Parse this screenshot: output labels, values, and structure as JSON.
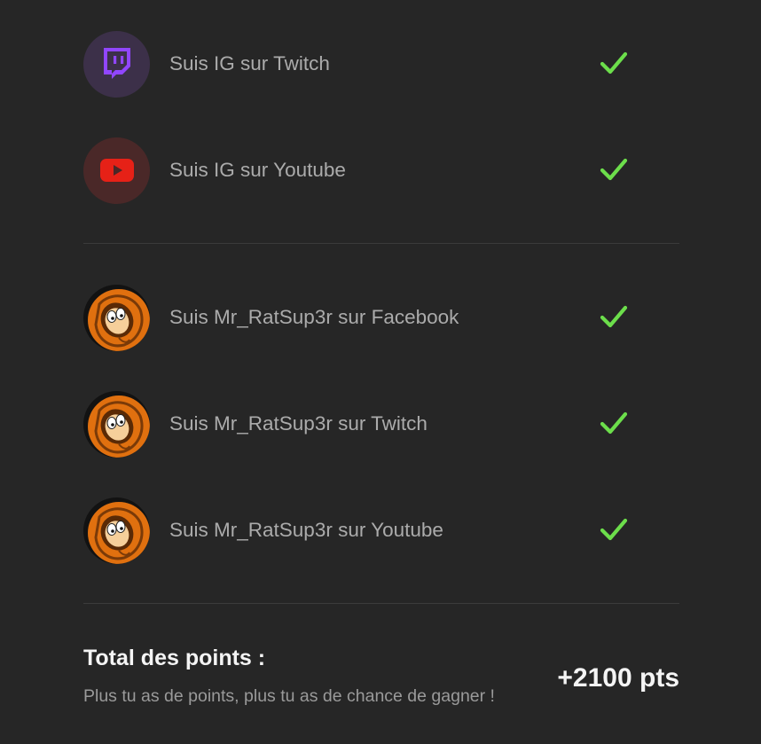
{
  "tasks_group_1": [
    {
      "label": "Suis IG sur Twitch",
      "icon": "twitch-icon",
      "completed": true
    },
    {
      "label": "Suis IG sur Youtube",
      "icon": "youtube-icon",
      "completed": true
    }
  ],
  "tasks_group_2": [
    {
      "label": "Suis Mr_RatSup3r sur Facebook",
      "icon": "kenny-avatar-icon",
      "completed": true
    },
    {
      "label": "Suis Mr_RatSup3r sur Twitch",
      "icon": "kenny-avatar-icon",
      "completed": true
    },
    {
      "label": "Suis Mr_RatSup3r sur Youtube",
      "icon": "kenny-avatar-icon",
      "completed": true
    }
  ],
  "total": {
    "title": "Total des points :",
    "subtitle": "Plus tu as de points, plus tu as de chance de gagner !",
    "points": "+2100 pts"
  },
  "colors": {
    "background": "#262626",
    "check": "#6cde4b",
    "twitch_purple": "#9146ff",
    "youtube_red": "#e62117",
    "divider": "#3b3b3b"
  }
}
